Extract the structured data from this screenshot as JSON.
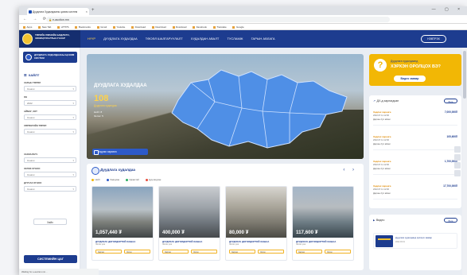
{
  "browser": {
    "tab_title": "Дуудлага Худалдааны цахим систем",
    "url": "e-auction.mn",
    "bookmarks": [
      "Apps",
      "New Tab",
      "HTTPS",
      "Bookmarks",
      "Gmail",
      "Youtube",
      "Download",
      "Download",
      "Download",
      "Facebook",
      "Translate",
      "Google"
    ]
  },
  "header": {
    "logo_text": "ТӨРИЙН ӨМЧИЙН БОДЛОГО, ЗОХИЦУУЛАЛТЫН ГАЗАР",
    "menu": [
      "НҮҮР",
      "ДУУДЛАГА ХУДАЛДАА",
      "ТӨСӨЛ ШАЛГАРУУЛАЛТ",
      "ХУДАЛДАН АВАЛТ",
      "ТУСЛАМЖ",
      "ГАРЫН АВЛАГА"
    ],
    "login": "НЭВТРЭХ"
  },
  "sidebar": {
    "head": "ДУУДЛАГА ХУДАЛДААНЫ ЦАХИМ СИСТЕМ",
    "filter_title": "ХАЙЛТ",
    "fields": [
      {
        "label": "ЗАРЫН ТӨРӨЛ",
        "value": "Сонгох"
      },
      {
        "label": "ОН",
        "value": "2022"
      },
      {
        "label": "АЙМАГ, ХОТ",
        "value": "Сонгох"
      },
      {
        "label": "ХӨРӨНГИЙН ТӨРӨЛ",
        "value": "Сонгох"
      },
      {
        "label": "ЗАХИАЛАГЧ",
        "value": "Сонгох"
      },
      {
        "label": "ЭХЛЭХ ОГНОО",
        "value": "Сонгох"
      },
      {
        "label": "ДУУСАХ ОГНОО",
        "value": "Сонгох"
      }
    ],
    "search_button": "Хайх",
    "cta": "СИСТЕМИЙН ЦАГ"
  },
  "hero": {
    "title": "ДУУДЛАГА ХУДАЛДАА",
    "count": "108",
    "unit": "Дуудлага худалдаа",
    "line1": "Нийт: 8",
    "line2": "Эхлэх: 5",
    "button": "Хөдлөх хөрөнгө"
  },
  "auctions": {
    "title": "Дуудлага худалдаа",
    "legend": [
      {
        "label": "Нийт",
        "color": "#f2b705"
      },
      {
        "label": "Хаагдсан",
        "color": "#2d5ac8"
      },
      {
        "label": "Идэвхтэй",
        "color": "#27ae60"
      },
      {
        "label": "Цуцлагдсан",
        "color": "#e74c3c"
      }
    ],
    "cards": [
      {
        "price": "1,057,440 ₮",
        "title": "ДУУДЛАГА ДОГОЛДОРТОЙ ХАШАА",
        "sub": "Эхлэх үнэ",
        "chip1": "Зарлах",
        "chip2": "Эхлэх"
      },
      {
        "price": "400,000 ₮",
        "title": "ДУУДЛАГА ДОГОЛДОРТОЙ ХАШАА",
        "sub": "Эхлэх үнэ",
        "chip1": "Зарлах",
        "chip2": "Эхлэх"
      },
      {
        "price": "80,000 ₮",
        "title": "ДУУДЛАГА ДОГОЛДОРТОЙ ХАШАА",
        "sub": "Эхлэх үнэ",
        "chip1": "Зарлах",
        "chip2": "Эхлэх"
      },
      {
        "price": "117,600 ₮",
        "title": "ДУУДЛАГА ДОГОЛДОРТОЙ ХАШАА",
        "sub": "Эхлэх үнэ",
        "chip1": "Зарлах",
        "chip2": "Эхлэх"
      }
    ]
  },
  "promo": {
    "line1": "Дуудлага худалдаанд",
    "line2": "ХЭРХЭН ОРОЛЦОХ ВЭ?",
    "button": "Видео заавар"
  },
  "list": {
    "title": "ДХ-д зарлагдсан",
    "more": "Бүгд",
    "items": [
      {
        "name": "Хөдлөх хөрөнгө",
        "date": "2022.07.11 12:00",
        "sub": "Дархан-Уул аймаг",
        "value": "7,000,000₮"
      },
      {
        "name": "Хөдлөх хөрөнгө",
        "date": "2022.07.11 12:00",
        "sub": "Дархан-Уул аймаг",
        "value": "105,600₮"
      },
      {
        "name": "Хөдлөх хөрөнгө",
        "date": "2022.07.11 12:00",
        "sub": "Дархан-Уул аймаг",
        "value": "1,700,000₮"
      },
      {
        "name": "Хөдлөх хөрөнгө",
        "date": "2022.07.11 12:00",
        "sub": "Дархан-Уул аймаг",
        "value": "17,700,000₮"
      }
    ]
  },
  "video": {
    "title": "Видео",
    "more": "Бүгд",
    "item_title": "Дуудлага худалдаанд оролцох заавар",
    "item_date": "2022.03.01"
  },
  "status": "Waiting for e-auction.mn..."
}
